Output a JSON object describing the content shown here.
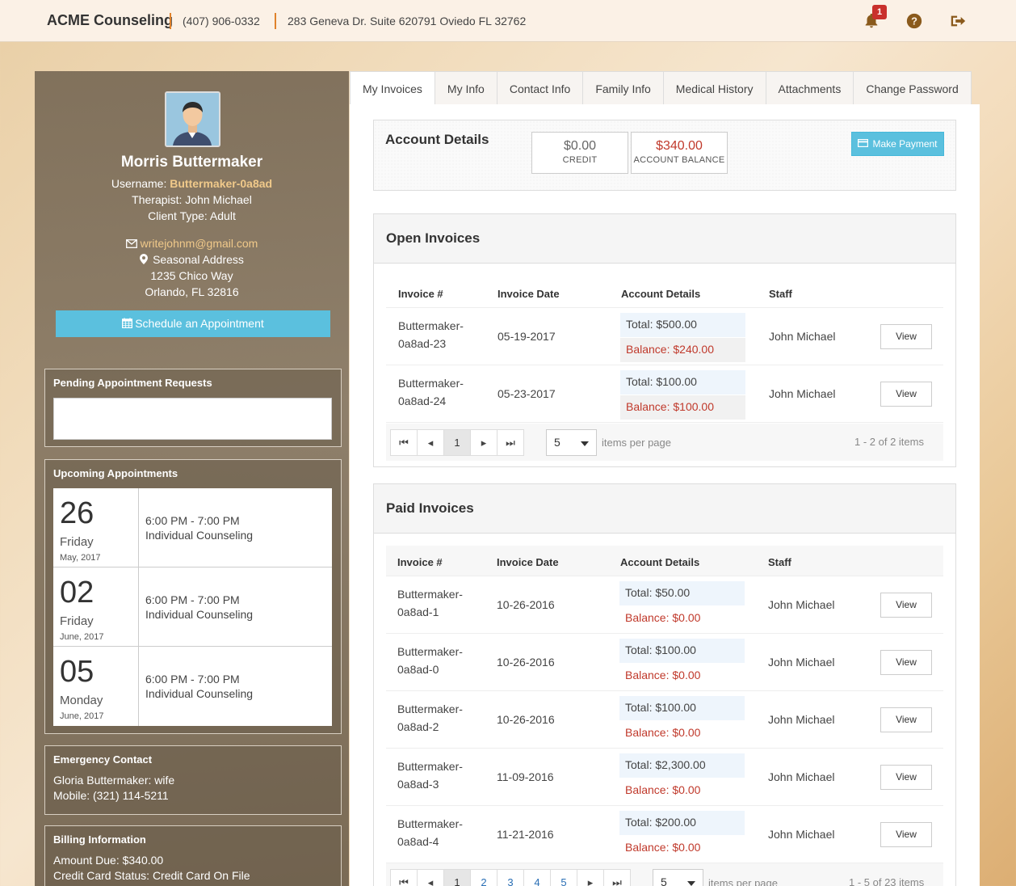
{
  "header": {
    "brand": "ACME Counseling",
    "phone": "(407) 906-0332",
    "address": "283 Geneva Dr. Suite 620791 Oviedo FL 32762",
    "notification_count": "1",
    "icons": [
      "bell-icon",
      "help-icon",
      "logout-icon"
    ]
  },
  "profile": {
    "name": "Morris Buttermaker",
    "username_label": "Username:",
    "username": "Buttermaker-0a8ad",
    "therapist": "Therapist: John Michael",
    "client_type": "Client Type: Adult",
    "email": "writejohnm@gmail.com",
    "address_label": "Seasonal Address",
    "street": "1235 Chico Way",
    "city": "Orlando, FL 32816",
    "schedule_button": "Schedule an Appointment"
  },
  "pending": {
    "title": "Pending Appointment Requests"
  },
  "upcoming": {
    "title": "Upcoming Appointments",
    "items": [
      {
        "day": "26",
        "weekday": "Friday",
        "month_year": "May, 2017",
        "time": "6:00 PM - 7:00 PM",
        "type": "Individual Counseling"
      },
      {
        "day": "02",
        "weekday": "Friday",
        "month_year": "June, 2017",
        "time": "6:00 PM - 7:00 PM",
        "type": "Individual Counseling"
      },
      {
        "day": "05",
        "weekday": "Monday",
        "month_year": "June, 2017",
        "time": "6:00 PM - 7:00 PM",
        "type": "Individual Counseling"
      }
    ]
  },
  "emergency": {
    "title": "Emergency Contact",
    "contact": "Gloria Buttermaker: wife",
    "mobile": "Mobile: (321) 114-5211"
  },
  "billing": {
    "title": "Billing Information",
    "amount_due": "Amount Due: $340.00",
    "card_status": "Credit Card Status: Credit Card On File"
  },
  "tabs": [
    "My Invoices",
    "My Info",
    "Contact Info",
    "Family Info",
    "Medical History",
    "Attachments",
    "Change Password"
  ],
  "account": {
    "title": "Account Details",
    "credit_value": "$0.00",
    "credit_label": "CREDIT",
    "balance_value": "$340.00",
    "balance_label": "ACCOUNT BALANCE",
    "pay_button": "Make Payment"
  },
  "columns": [
    "Invoice #",
    "Invoice Date",
    "Account Details",
    "Staff"
  ],
  "open_invoices": {
    "title": "Open Invoices",
    "rows": [
      {
        "id1": "Buttermaker-",
        "id2": "0a8ad-23",
        "date": "05-19-2017",
        "total": "Total: $500.00",
        "balance": "Balance: $240.00",
        "staff": "John Michael",
        "view": "View"
      },
      {
        "id1": "Buttermaker-",
        "id2": "0a8ad-24",
        "date": "05-23-2017",
        "total": "Total: $100.00",
        "balance": "Balance: $100.00",
        "staff": "John Michael",
        "view": "View"
      }
    ],
    "page": "1",
    "page_size": "5",
    "items_per_page": "items per page",
    "summary": "1 - 2 of 2 items"
  },
  "paid_invoices": {
    "title": "Paid Invoices",
    "rows": [
      {
        "id1": "Buttermaker-",
        "id2": "0a8ad-1",
        "date": "10-26-2016",
        "total": "Total: $50.00",
        "balance": "Balance: $0.00",
        "staff": "John Michael",
        "view": "View"
      },
      {
        "id1": "Buttermaker-",
        "id2": "0a8ad-0",
        "date": "10-26-2016",
        "total": "Total: $100.00",
        "balance": "Balance: $0.00",
        "staff": "John Michael",
        "view": "View"
      },
      {
        "id1": "Buttermaker-",
        "id2": "0a8ad-2",
        "date": "10-26-2016",
        "total": "Total: $100.00",
        "balance": "Balance: $0.00",
        "staff": "John Michael",
        "view": "View"
      },
      {
        "id1": "Buttermaker-",
        "id2": "0a8ad-3",
        "date": "11-09-2016",
        "total": "Total: $2,300.00",
        "balance": "Balance: $0.00",
        "staff": "John Michael",
        "view": "View"
      },
      {
        "id1": "Buttermaker-",
        "id2": "0a8ad-4",
        "date": "11-21-2016",
        "total": "Total: $200.00",
        "balance": "Balance: $0.00",
        "staff": "John Michael",
        "view": "View"
      }
    ],
    "pages": [
      "1",
      "2",
      "3",
      "4",
      "5"
    ],
    "page_size": "5",
    "items_per_page": "items per page",
    "summary": "1 - 5 of 23 items"
  },
  "colors": {
    "accent": "#5bc0de",
    "balance_red": "#c0392b",
    "separator_orange": "#e0822b",
    "badge_red": "#c9302c",
    "icon_brown": "#8a5a1c"
  }
}
